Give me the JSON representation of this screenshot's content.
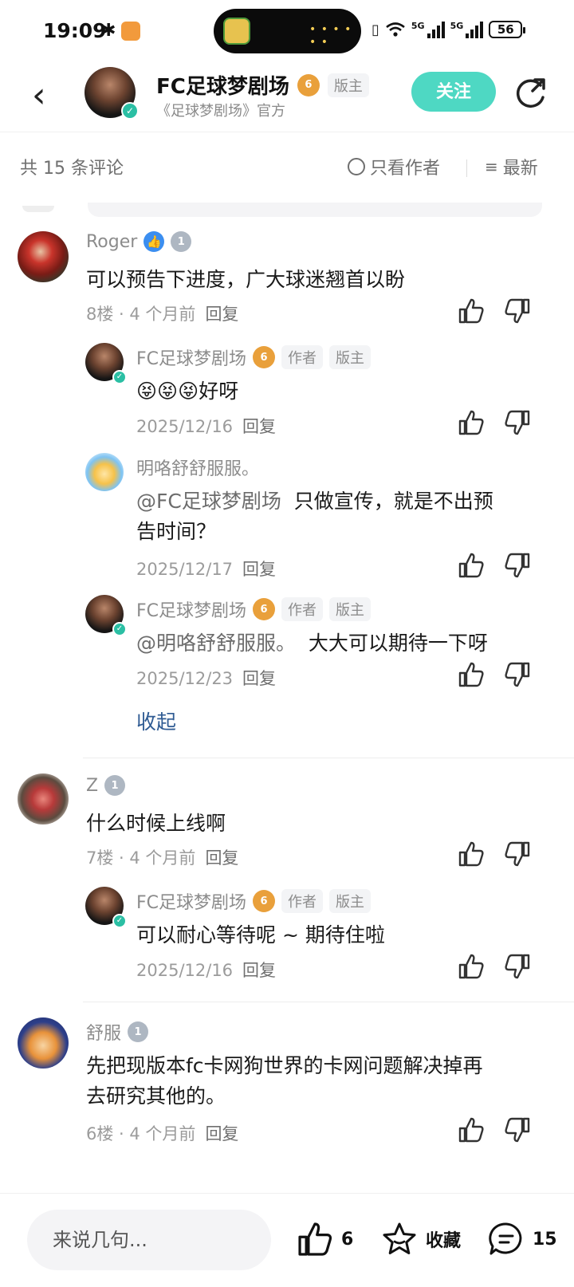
{
  "status_bar": {
    "time": "19:09",
    "network_label_1": "5G",
    "network_label_2": "5G",
    "battery": "56"
  },
  "header": {
    "title": "FC足球梦剧场",
    "level": "6",
    "tag": "版主",
    "subtitle": "《足球梦剧场》官方",
    "follow_label": "关注"
  },
  "sortbar": {
    "count_label": "共 15 条评论",
    "only_author_label": "只看作者",
    "sort_label": "最新"
  },
  "comments": [
    {
      "name": "Roger",
      "text": "可以预告下进度，广大球迷翘首以盼",
      "floor": "8楼 · 4 个月前",
      "reply": "回复",
      "replies": [
        {
          "name": "FC足球梦剧场",
          "level": "6",
          "tag1": "作者",
          "tag2": "版主",
          "emoji": "😝😝😝",
          "text": "好呀",
          "date": "2025/12/16",
          "reply": "回复"
        },
        {
          "name": "明咯舒舒服服。",
          "mention": "@FC足球梦剧场",
          "text_line1": "只做宣传，就是不出预",
          "text_line2": "告时间？",
          "date": "2025/12/17",
          "reply": "回复"
        },
        {
          "name": "FC足球梦剧场",
          "level": "6",
          "tag1": "作者",
          "tag2": "版主",
          "mention": "@明咯舒舒服服。",
          "text": "大大可以期待一下呀",
          "date": "2025/12/23",
          "reply": "回复"
        }
      ],
      "collapse_label": "收起"
    },
    {
      "name": "Z",
      "text": "什么时候上线啊",
      "floor": "7楼 · 4 个月前",
      "reply": "回复",
      "replies": [
        {
          "name": "FC足球梦剧场",
          "level": "6",
          "tag1": "作者",
          "tag2": "版主",
          "text": "可以耐心等待呢 ~ 期待住啦",
          "date": "2025/12/16",
          "reply": "回复"
        }
      ]
    },
    {
      "name": "舒服",
      "text_line1": "先把现版本fc卡网狗世界的卡网问题解决掉再",
      "text_line2": "去研究其他的。",
      "floor": "6楼 · 4 个月前",
      "reply": "回复"
    }
  ],
  "bottom_bar": {
    "input_placeholder": "来说几句...",
    "like_count": "6",
    "favorite_label": "收藏",
    "comment_count": "15"
  },
  "colors": {
    "accent": "#4ed8c3",
    "link": "#2f5b93",
    "level_badge": "#e9a03b"
  }
}
